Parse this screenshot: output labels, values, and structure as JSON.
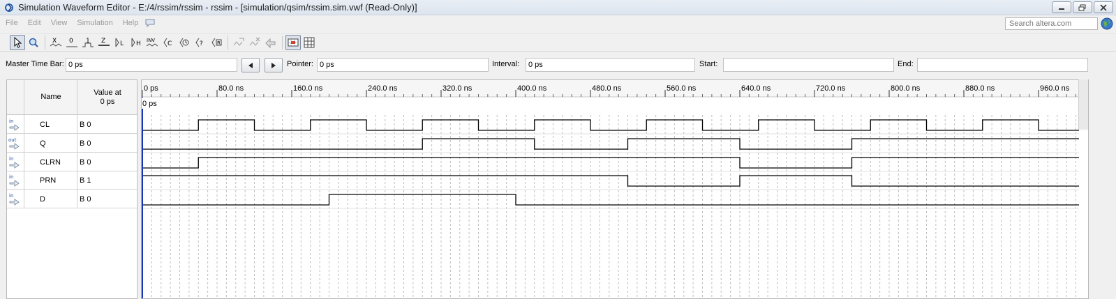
{
  "window": {
    "title": "Simulation Waveform Editor - E:/4/rssim/rssim - rssim - [simulation/qsim/rssim.sim.vwf (Read-Only)]"
  },
  "menu": {
    "items": [
      "File",
      "Edit",
      "View",
      "Simulation",
      "Help"
    ]
  },
  "search": {
    "placeholder": "Search altera.com"
  },
  "toolbar": {
    "icons": [
      "selection-tool-icon",
      "zoom-tool-icon",
      "forcing-unknown-icon",
      "forcing-low-icon",
      "forcing-high-icon",
      "high-impedance-icon",
      "weak-low-icon",
      "weak-high-icon",
      "invert-icon",
      "count-value-icon",
      "clock-value-icon",
      "arbitrary-value-icon",
      "random-value-icon",
      "snap-to-grid-icon",
      "grid-settings-icon"
    ]
  },
  "timebar": {
    "master_label": "Master Time Bar:",
    "master_value": "0 ps",
    "pointer_label": "Pointer:",
    "pointer_value": "0 ps",
    "interval_label": "Interval:",
    "interval_value": "0 ps",
    "start_label": "Start:",
    "start_value": "",
    "end_label": "End:",
    "end_value": ""
  },
  "table": {
    "name_header": "Name",
    "value_header_line1": "Value at",
    "value_header_line2": "0 ps"
  },
  "waveform": {
    "time_unit": "ns",
    "time_range_ns": [
      0,
      1000
    ],
    "ticks": [
      "0 ps",
      "80.0 ns",
      "160.0 ns",
      "240.0 ns",
      "320.0 ns",
      "400.0 ns",
      "480.0 ns",
      "560.0 ns",
      "640.0 ns",
      "720.0 ns",
      "800.0 ns",
      "880.0 ns",
      "960.0 ns"
    ],
    "cursor_label": "0 ps",
    "signals": [
      {
        "type": "in",
        "name": "CL",
        "value": "B 0",
        "initial": 0,
        "transitions_ns": [
          60,
          120,
          180,
          240,
          300,
          360,
          420,
          480,
          540,
          600,
          660,
          720,
          780,
          840,
          900,
          960
        ]
      },
      {
        "type": "out",
        "name": "Q",
        "value": "B 0",
        "initial": 0,
        "transitions_ns": [
          300,
          420,
          520,
          640,
          760
        ]
      },
      {
        "type": "in",
        "name": "CLRN",
        "value": "B 0",
        "initial": 0,
        "transitions_ns": [
          60,
          640,
          760
        ]
      },
      {
        "type": "in",
        "name": "PRN",
        "value": "B 1",
        "initial": 1,
        "transitions_ns": [
          520,
          640,
          760
        ]
      },
      {
        "type": "in",
        "name": "D",
        "value": "B 0",
        "initial": 0,
        "transitions_ns": [
          200,
          400
        ]
      }
    ]
  }
}
